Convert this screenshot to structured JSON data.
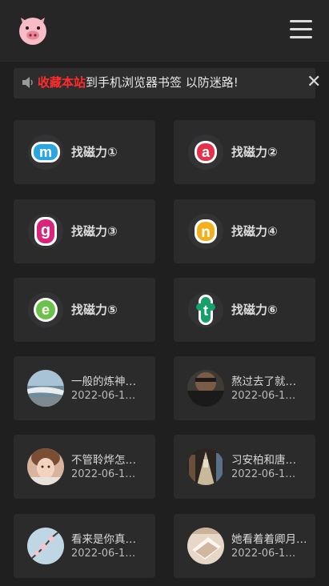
{
  "header": {
    "logo_icon": "pig-face-icon",
    "menu_icon": "hamburger-menu-icon"
  },
  "notice": {
    "highlight": "收藏本站",
    "text": "到手机浏览器书签 以防迷路!",
    "close": "✕",
    "highlight_color": "#ff2b2b"
  },
  "links": [
    {
      "letter": "m",
      "label": "找磁力①",
      "color": "#2aa6e0"
    },
    {
      "letter": "a",
      "label": "找磁力②",
      "color": "#e4324c"
    },
    {
      "letter": "g",
      "label": "找磁力③",
      "color": "#d8247a"
    },
    {
      "letter": "n",
      "label": "找磁力④",
      "color": "#f2b01e"
    },
    {
      "letter": "e",
      "label": "找磁力⑤",
      "color": "#6cc14a"
    },
    {
      "letter": "t",
      "label": "找磁力⑥",
      "color": "#18a06a"
    }
  ],
  "articles": [
    {
      "title": "一般的炼神…",
      "date": "2022-06-1…",
      "avatar": "seascape-photo"
    },
    {
      "title": "熬过去了就…",
      "date": "2022-06-1…",
      "avatar": "portrait-photo"
    },
    {
      "title": "不管聆烨怎…",
      "date": "2022-06-1…",
      "avatar": "girl-photo"
    },
    {
      "title": "习安柏和唐…",
      "date": "2022-06-1…",
      "avatar": "street-photo"
    },
    {
      "title": "看来是你真…",
      "date": "2022-06-1…",
      "avatar": "blossom-photo"
    },
    {
      "title": "她看着着卿月…",
      "date": "2022-06-1…",
      "avatar": "books-photo"
    }
  ]
}
